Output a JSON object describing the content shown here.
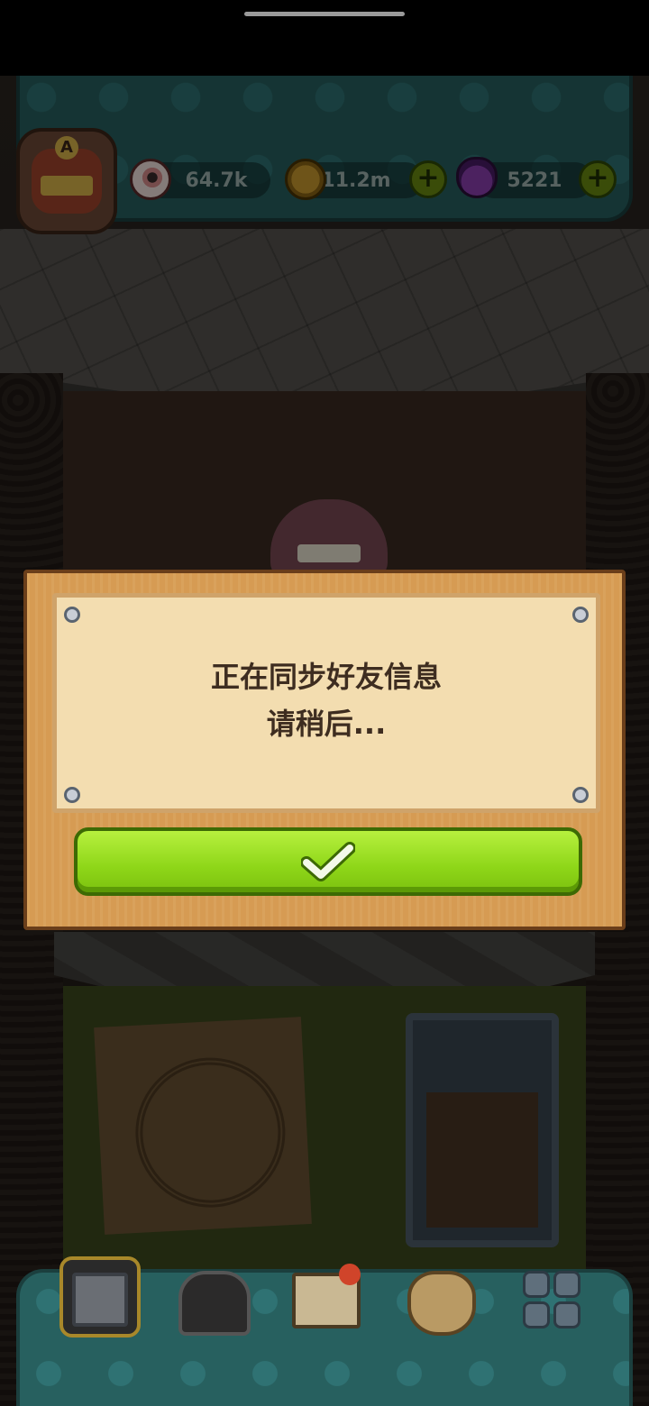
{
  "hud": {
    "avatar_letter": "A",
    "eyeballs": "64.7k",
    "coins": "11.2m",
    "potions": "5221",
    "plus": "+"
  },
  "dialog": {
    "line1": "正在同步好友信息",
    "line2": "请稍后..."
  },
  "colors": {
    "confirm_green": "#8ed618",
    "dialog_wood": "#d8a05a",
    "hud_teal": "#27605f"
  },
  "icons": {
    "confirm": "check-icon",
    "resources": [
      "eyeball-icon",
      "coin-icon",
      "potion-icon"
    ],
    "nav": [
      "building-icon",
      "monster-cage-icon",
      "book-icon",
      "money-bag-icon",
      "grid-menu-icon"
    ]
  }
}
